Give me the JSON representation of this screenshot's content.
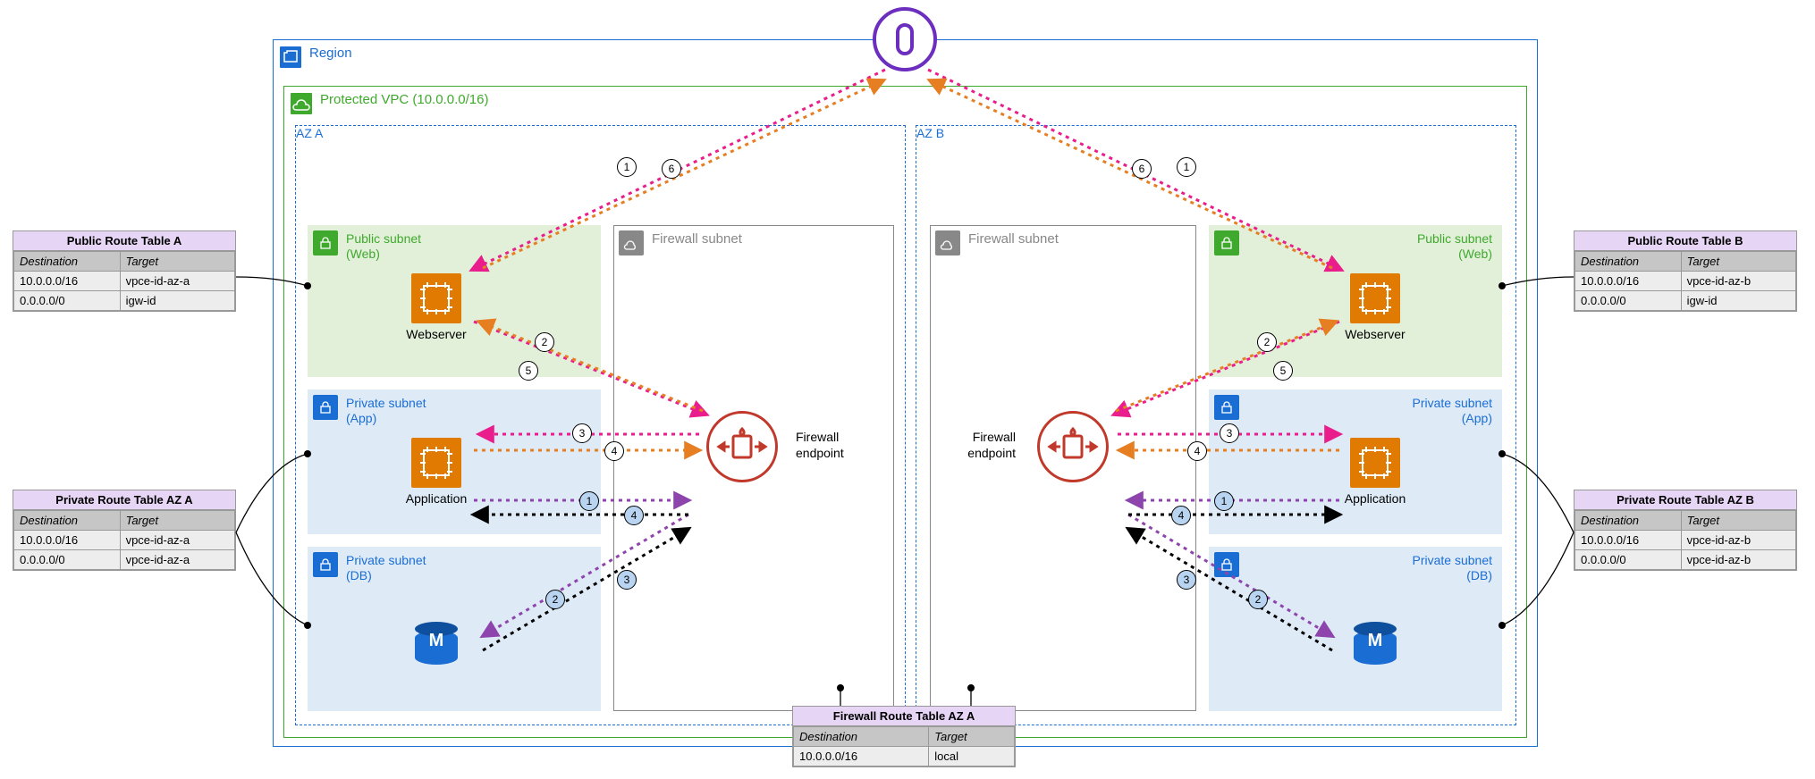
{
  "region": {
    "label": "Region"
  },
  "vpc": {
    "label": "Protected VPC (10.0.0.0/16)"
  },
  "az": {
    "a": "AZ A",
    "b": "AZ B"
  },
  "subnets": {
    "public": {
      "title1": "Public subnet",
      "title2": "(Web)"
    },
    "privateApp": {
      "title1": "Private subnet",
      "title2": "(App)"
    },
    "privateDb": {
      "title1": "Private subnet",
      "title2": "(DB)"
    },
    "firewall": {
      "title": "Firewall subnet"
    }
  },
  "labels": {
    "webserver": "Webserver",
    "application": "Application",
    "firewallEndpoint": "Firewall\nendpoint",
    "firewallEndpointL1": "Firewall",
    "firewallEndpointL2": "endpoint"
  },
  "routeTables": {
    "publicA": {
      "title": "Public Route Table A",
      "headers": [
        "Destination",
        "Target"
      ],
      "rows": [
        [
          "10.0.0.0/16",
          "vpce-id-az-a"
        ],
        [
          "0.0.0.0/0",
          "igw-id"
        ]
      ]
    },
    "publicB": {
      "title": "Public Route Table B",
      "headers": [
        "Destination",
        "Target"
      ],
      "rows": [
        [
          "10.0.0.0/16",
          "vpce-id-az-b"
        ],
        [
          "0.0.0.0/0",
          "igw-id"
        ]
      ]
    },
    "privateA": {
      "title": "Private Route Table AZ A",
      "headers": [
        "Destination",
        "Target"
      ],
      "rows": [
        [
          "10.0.0.0/16",
          "vpce-id-az-a"
        ],
        [
          "0.0.0.0/0",
          "vpce-id-az-a"
        ]
      ]
    },
    "privateB": {
      "title": "Private Route Table AZ B",
      "headers": [
        "Destination",
        "Target"
      ],
      "rows": [
        [
          "10.0.0.0/16",
          "vpce-id-az-b"
        ],
        [
          "0.0.0.0/0",
          "vpce-id-az-b"
        ]
      ]
    },
    "firewallA": {
      "title": "Firewall Route Table AZ A",
      "headers": [
        "Destination",
        "Target"
      ],
      "rows": [
        [
          "10.0.0.0/16",
          "local"
        ]
      ]
    }
  },
  "dbLetter": "M",
  "flowNumbers": {
    "pink": [
      "1",
      "2",
      "3"
    ],
    "orange": [
      "4",
      "5",
      "6"
    ],
    "purple": [
      "1",
      "2"
    ],
    "black": [
      "3",
      "4"
    ]
  }
}
